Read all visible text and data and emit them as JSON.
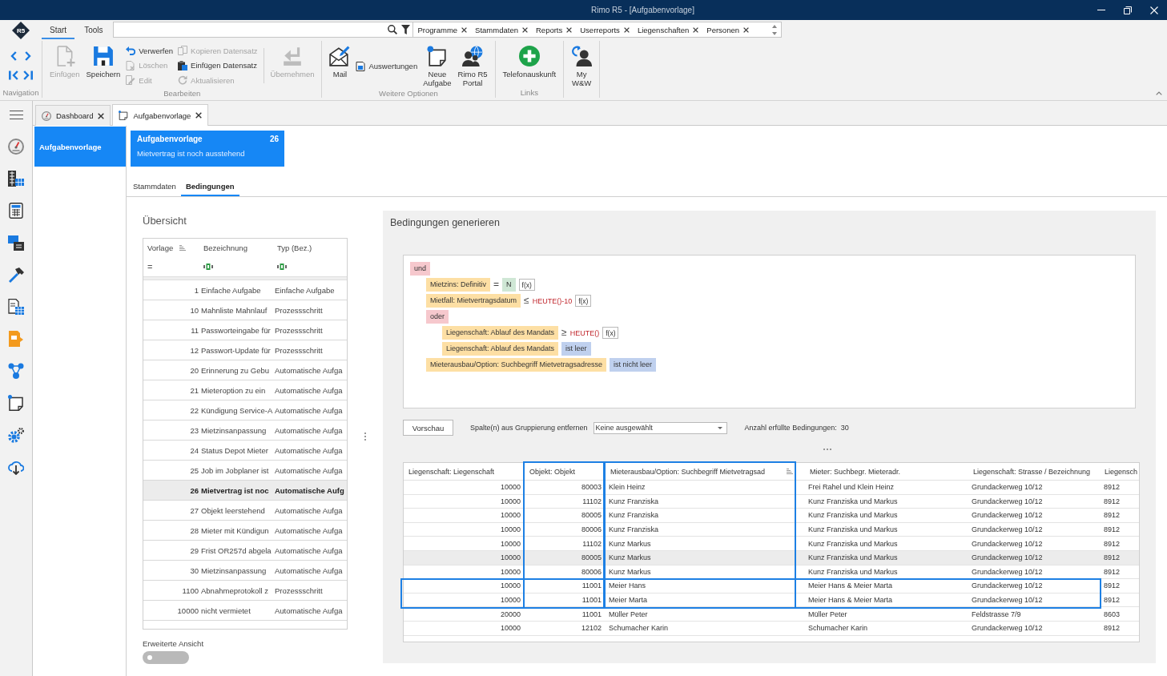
{
  "window": {
    "title": "Rimo R5 - [Aufgabenvorlage]"
  },
  "ribbon": {
    "logo": "R5",
    "tabs": [
      {
        "label": "Start",
        "selected": true
      },
      {
        "label": "Tools",
        "selected": false
      }
    ],
    "tags": [
      "Programme",
      "Stammdaten",
      "Reports",
      "Userreports",
      "Liegenschaften",
      "Personen"
    ],
    "groups": [
      {
        "kind": "navigation",
        "label": "Navigation"
      },
      {
        "kind": "buttons",
        "label": "Bearbeiten",
        "items": [
          {
            "kind": "large",
            "label": "Einfügen",
            "disabled": true
          },
          {
            "kind": "large",
            "label": "Speichern",
            "disabled": false
          },
          {
            "kind": "small",
            "label": "Verwerfen",
            "disabled": false
          },
          {
            "kind": "small",
            "label": "Löschen",
            "disabled": true
          },
          {
            "kind": "small",
            "label": "Edit",
            "disabled": true
          },
          {
            "kind": "small",
            "label": "Kopieren Datensatz",
            "disabled": true
          },
          {
            "kind": "small",
            "label": "Einfügen Datensatz",
            "disabled": false
          },
          {
            "kind": "small",
            "label": "Aktualisieren",
            "disabled": true
          },
          {
            "kind": "separator"
          },
          {
            "kind": "large",
            "label": "Übernehmen",
            "disabled": true
          }
        ]
      },
      {
        "kind": "buttons",
        "label": "Weitere Optionen",
        "items": [
          {
            "kind": "large",
            "label": "Mail",
            "disabled": false
          },
          {
            "kind": "small",
            "label": "Auswertungen",
            "disabled": false
          },
          {
            "kind": "large",
            "label": "Neue\nAufgabe",
            "disabled": false
          },
          {
            "kind": "large",
            "label": "Rimo R5\nPortal",
            "disabled": false
          }
        ]
      },
      {
        "kind": "buttons",
        "label": "Links",
        "items": [
          {
            "kind": "large",
            "label": "Telefonauskunft",
            "disabled": false
          }
        ]
      },
      {
        "kind": "buttons",
        "items": [
          {
            "kind": "large",
            "label": "My\nW&W",
            "disabled": false
          }
        ]
      }
    ]
  },
  "document_tabs": [
    {
      "label": "Dashboard",
      "selected": false
    },
    {
      "label": "Aufgabenvorlage",
      "selected": true
    }
  ],
  "navigation": {
    "items": [
      {
        "label": "Aufgabenvorlage",
        "selected": true
      }
    ]
  },
  "record_card": {
    "title": "Aufgabenvorlage",
    "number": "26",
    "subtitle": "Mietvertrag ist noch ausstehend"
  },
  "section_tabs": [
    {
      "label": "Stammdaten",
      "selected": false
    },
    {
      "label": "Bedingungen",
      "selected": true
    }
  ],
  "overview": {
    "title": "Übersicht",
    "columns": [
      {
        "label": "Vorlage",
        "sorted": true,
        "filter": {
          "kind": "operator",
          "text": "="
        }
      },
      {
        "label": "Bezeichnung",
        "sorted": false,
        "filter": {
          "kind": "text"
        }
      },
      {
        "label": "Typ (Bez.)",
        "sorted": false,
        "filter": {
          "kind": "text"
        }
      }
    ],
    "rows": [
      {
        "cells": [
          "1",
          "Einfache Aufgabe",
          "Einfache Aufgabe"
        ],
        "selected": false
      },
      {
        "cells": [
          "10",
          "Mahnliste Mahnlauf",
          "Prozessschritt"
        ],
        "selected": false
      },
      {
        "cells": [
          "11",
          "Passworteingabe für",
          "Prozessschritt"
        ],
        "selected": false
      },
      {
        "cells": [
          "12",
          "Passwort-Update für",
          "Prozessschritt"
        ],
        "selected": false
      },
      {
        "cells": [
          "20",
          "Erinnerung zu Gebu",
          "Automatische Aufga"
        ],
        "selected": false
      },
      {
        "cells": [
          "21",
          "Mieteroption zu ein",
          "Automatische Aufga"
        ],
        "selected": false
      },
      {
        "cells": [
          "22",
          "Kündigung Service-A",
          "Automatische Aufga"
        ],
        "selected": false
      },
      {
        "cells": [
          "23",
          "Mietzinsanpassung",
          "Automatische Aufga"
        ],
        "selected": false
      },
      {
        "cells": [
          "24",
          "Status Depot Mieter",
          "Automatische Aufga"
        ],
        "selected": false
      },
      {
        "cells": [
          "25",
          "Job im Jobplaner ist",
          "Automatische Aufga"
        ],
        "selected": false
      },
      {
        "cells": [
          "26",
          "Mietvertrag ist noc",
          "Automatische Aufg"
        ],
        "selected": true
      },
      {
        "cells": [
          "27",
          "Objekt leerstehend",
          "Automatische Aufga"
        ],
        "selected": false
      },
      {
        "cells": [
          "28",
          "Mieter mit Kündigun",
          "Automatische Aufga"
        ],
        "selected": false
      },
      {
        "cells": [
          "29",
          "Frist OR257d abgela",
          "Automatische Aufga"
        ],
        "selected": false
      },
      {
        "cells": [
          "30",
          "Mietzinsanpassung",
          "Automatische Aufga"
        ],
        "selected": false
      },
      {
        "cells": [
          "1100",
          "Abnahmeprotokoll z",
          "Prozessschritt"
        ],
        "selected": false
      },
      {
        "cells": [
          "10000",
          "nicht vermietet",
          "Automatische Aufga"
        ],
        "selected": false
      }
    ],
    "extended_view": {
      "label": "Erweiterte Ansicht",
      "on": false
    }
  },
  "conditions": {
    "title": "Bedingungen generieren",
    "tree": {
      "kind": "group",
      "label": "und",
      "children": [
        {
          "kind": "rule",
          "field": "Mietzins: Definitiv",
          "operator": {
            "kind": "symbol",
            "text": "="
          },
          "value": {
            "kind": "constant",
            "text": "N"
          },
          "function_button": "f(x)"
        },
        {
          "kind": "rule",
          "field": "Mietfall: Mietvertragsdatum",
          "operator": {
            "kind": "symbol",
            "text": "≤"
          },
          "value": {
            "kind": "function",
            "text": "HEUTE()-10"
          },
          "function_button": "f(x)"
        },
        {
          "kind": "group",
          "label": "oder",
          "children": [
            {
              "kind": "rule",
              "field": "Liegenschaft: Ablauf des Mandats",
              "operator": {
                "kind": "symbol",
                "text": "≥"
              },
              "value": {
                "kind": "function",
                "text": "HEUTE()"
              },
              "function_button": "f(x)"
            },
            {
              "kind": "rule",
              "field": "Liegenschaft: Ablauf des Mandats",
              "operator": {
                "kind": "test",
                "text": "ist leer"
              }
            }
          ]
        },
        {
          "kind": "rule",
          "field": "Mieterausbau/Option: Suchbegriff Mietvetragsadresse",
          "operator": {
            "kind": "test",
            "text": "ist nicht leer"
          }
        }
      ]
    },
    "preview_button": "Vorschau",
    "grouping_label": "Spalte(n) aus Gruppierung entfernen",
    "grouping_select": {
      "value": "Keine ausgewählt"
    },
    "count_label": "Anzahl erfüllte Bedingungen:",
    "count": "30"
  },
  "results": {
    "columns": [
      {
        "label": "Liegenschaft: Liegenschaft",
        "kind": "number",
        "sorted": false,
        "highlighted": false
      },
      {
        "label": "Objekt: Objekt",
        "kind": "number",
        "sorted": false,
        "highlighted": true
      },
      {
        "label": "Mieterausbau/Option: Suchbegriff Mietvetragsad",
        "kind": "text",
        "sorted": true,
        "highlighted": true
      },
      {
        "label": "Mieter: Suchbegr. Mieteradr.",
        "kind": "text",
        "sorted": false,
        "highlighted": false
      },
      {
        "label": "Liegenschaft: Strasse / Bezeichnung",
        "kind": "text",
        "sorted": false,
        "highlighted": false
      },
      {
        "label": "Liegensch",
        "kind": "text",
        "sorted": false,
        "highlighted": false
      }
    ],
    "rows": [
      {
        "cells": [
          "10000",
          "80003",
          "Klein Heinz",
          "Frei Rahel und Klein Heinz",
          "Grundackerweg 10/12",
          "8912"
        ],
        "selected": false,
        "highlighted": false
      },
      {
        "cells": [
          "10000",
          "11102",
          "Kunz Franziska",
          "Kunz Franziska und Markus",
          "Grundackerweg 10/12",
          "8912"
        ],
        "selected": false,
        "highlighted": false
      },
      {
        "cells": [
          "10000",
          "80005",
          "Kunz Franziska",
          "Kunz Franziska und Markus",
          "Grundackerweg 10/12",
          "8912"
        ],
        "selected": false,
        "highlighted": false
      },
      {
        "cells": [
          "10000",
          "80006",
          "Kunz Franziska",
          "Kunz Franziska und Markus",
          "Grundackerweg 10/12",
          "8912"
        ],
        "selected": false,
        "highlighted": false
      },
      {
        "cells": [
          "10000",
          "11102",
          "Kunz Markus",
          "Kunz Franziska und Markus",
          "Grundackerweg 10/12",
          "8912"
        ],
        "selected": false,
        "highlighted": false
      },
      {
        "cells": [
          "10000",
          "80005",
          "Kunz Markus",
          "Kunz Franziska und Markus",
          "Grundackerweg 10/12",
          "8912"
        ],
        "selected": true,
        "highlighted": false
      },
      {
        "cells": [
          "10000",
          "80006",
          "Kunz Markus",
          "Kunz Franziska und Markus",
          "Grundackerweg 10/12",
          "8912"
        ],
        "selected": false,
        "highlighted": false
      },
      {
        "cells": [
          "10000",
          "11001",
          "Meier Hans",
          "Meier Hans & Meier Marta",
          "Grundackerweg 10/12",
          "8912"
        ],
        "selected": false,
        "highlighted": true
      },
      {
        "cells": [
          "10000",
          "11001",
          "Meier Marta",
          "Meier Hans & Meier Marta",
          "Grundackerweg 10/12",
          "8912"
        ],
        "selected": false,
        "highlighted": true
      },
      {
        "cells": [
          "20000",
          "11001",
          "Müller Peter",
          "Müller Peter",
          "Feldstrasse 7/9",
          "8603"
        ],
        "selected": false,
        "highlighted": false
      },
      {
        "cells": [
          "10000",
          "12102",
          "Schumacher Karin",
          "Schumacher Karin",
          "Grundackerweg 10/12",
          "8912"
        ],
        "selected": false,
        "highlighted": false
      }
    ]
  }
}
